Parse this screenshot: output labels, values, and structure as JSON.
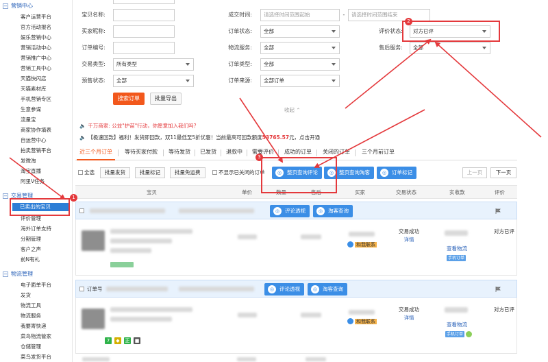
{
  "sidebar": {
    "sections": [
      {
        "title": "营销中心",
        "items": [
          "客户运营平台",
          "官方活动报名",
          "娱乐营销中心",
          "营销活动中心",
          "营销推广中心",
          "营销工具中心",
          "天猫快闪店",
          "天猫素材库",
          "手机营销专区",
          "生意参谋",
          "流量宝",
          "商家协作填表",
          "自运营中心",
          "拍卖营销平台",
          "发微淘",
          "淘宝直播",
          "阿里V任务"
        ]
      },
      {
        "title": "交易管理",
        "items": [
          "已卖出的宝贝",
          "评价管理",
          "海外订单支持",
          "分期管理",
          "客户之声",
          "前N有礼"
        ]
      },
      {
        "title": "物流管理",
        "items": [
          "电子面单平台",
          "发货",
          "物流工具",
          "物流服务",
          "我要寄快递",
          "菜鸟物流管家",
          "仓储管理",
          "菜鸟发货平台"
        ]
      }
    ]
  },
  "filters": {
    "item_name_label": "宝贝名称:",
    "buyer_nick_label": "买家昵称:",
    "order_no_label": "订单编号:",
    "trade_type_label": "交易类型:",
    "trade_type_value": "所有类型",
    "presale_label": "预售状态:",
    "presale_value": "全部",
    "deal_time_label": "成交时间:",
    "deal_time_start": "请选择时间范围起始",
    "deal_time_sep": "-",
    "deal_time_end": "请选择时间范围结束",
    "order_status_label": "订单状态:",
    "order_status_value": "全部",
    "logistics_label": "物流服务:",
    "logistics_value": "全部",
    "order_type_label": "订单类型:",
    "order_type_value": "全部",
    "order_source_label": "订单来源:",
    "order_source_value": "全部订单",
    "review_status_label": "评价状态:",
    "review_status_value": "对方已评",
    "aftersale_label": "售后服务:",
    "aftersale_value": "全部",
    "search_button": "搜索订单",
    "export_button": "批量导出",
    "collapse": "收起 ⌃"
  },
  "notices": {
    "notice1": "千万商家: 公益\"护苗\"行动，你愿意加入我们吗？",
    "notice2_a": "【极速回款】福利！发货即回款，双11最低至5折优惠！当前最高可回款额度",
    "notice2_amount": "53765.57",
    "notice2_b": "元，点击开通"
  },
  "tabs": [
    "近三个月订单",
    "等待买家付款",
    "等待发货",
    "已发货",
    "退款中",
    "需要评价",
    "成功的订单",
    "关闭的订单",
    "三个月前订单"
  ],
  "toolbar": {
    "select_all": "全选",
    "batch_ship": "批量发货",
    "batch_mark": "批量标记",
    "batch_free": "批量免运费",
    "hide_closed": "不显示已关闭的订单",
    "page_review_query": "整页查询评论",
    "page_taoke_query": "整页查询淘客",
    "order_highlight": "订单标记",
    "prev_page": "上一页",
    "next_page": "下一页"
  },
  "table": {
    "headers": [
      "宝贝",
      "单价",
      "数量",
      "售后",
      "买家",
      "交易状态",
      "实收款",
      "评价"
    ],
    "orders": [
      {
        "order_label": "",
        "review_btn": "评论透视",
        "taoke_btn": "淘客查询",
        "status": "交易成功",
        "detail": "详情",
        "view_logistics": "查看物流",
        "mobile_tag": "手机订单",
        "review": "对方已评",
        "contact": "和我联系"
      },
      {
        "order_label": "订单号",
        "review_btn": "评论透视",
        "taoke_btn": "淘客查询",
        "status": "交易成功",
        "detail": "详情",
        "view_logistics": "查看物流",
        "mobile_tag": "手机订单",
        "review": "对方已评",
        "contact": "和我联系"
      }
    ]
  },
  "annotations": {
    "n1": "1",
    "n2": "2",
    "n3": "3"
  },
  "colors": {
    "accent_orange": "#f2581c",
    "link_blue": "#2a62b8",
    "button_blue": "#3b8ee6",
    "annotation_red": "#e4393c"
  }
}
